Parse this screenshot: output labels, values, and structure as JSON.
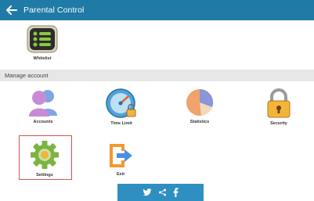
{
  "header": {
    "title": "Parental Control",
    "back_icon": "arrow-left-icon"
  },
  "whitelist": {
    "label": "Whitelist",
    "icon": "list-icon"
  },
  "section": {
    "title": "Manage account"
  },
  "tiles": [
    {
      "label": "Accounts",
      "icon": "users-icon"
    },
    {
      "label": "Time Limit",
      "icon": "speedometer-lock-icon"
    },
    {
      "label": "Statistics",
      "icon": "pie-chart-icon"
    },
    {
      "label": "Security",
      "icon": "padlock-icon"
    },
    {
      "label": "Settings",
      "icon": "gear-icon"
    },
    {
      "label": "Exit",
      "icon": "exit-icon"
    }
  ],
  "share": {
    "twitter": "twitter-icon",
    "share": "share-icon",
    "facebook": "facebook-icon"
  },
  "colors": {
    "header": "#1f7aa6",
    "highlight": "#d9534f",
    "share_bar": "#2f8fc1"
  }
}
